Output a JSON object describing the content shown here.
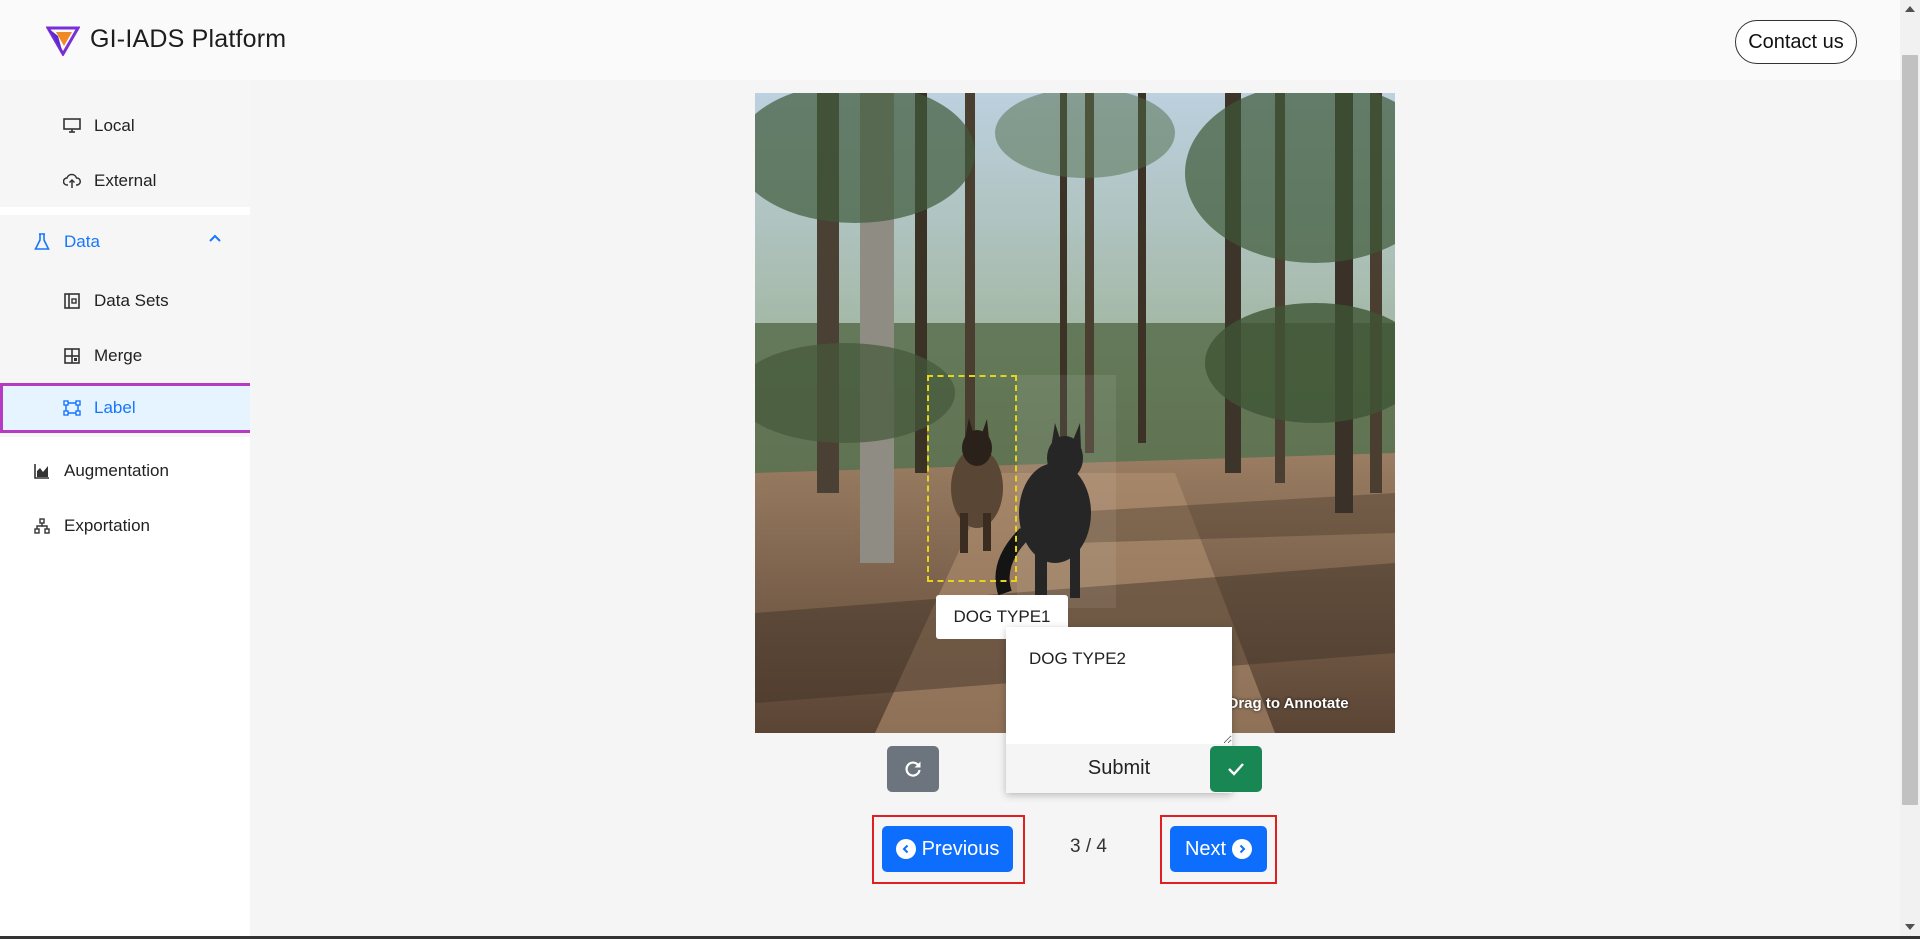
{
  "header": {
    "brand": "GI-IADS Platform",
    "contact_label": "Contact us",
    "logo_icon": "gi-iads-logo-icon"
  },
  "sidebar": {
    "items": [
      {
        "label": "Local",
        "icon": "monitor-icon"
      },
      {
        "label": "External",
        "icon": "cloud-upload-icon"
      },
      {
        "label": "Data",
        "icon": "flask-icon",
        "expanded": true
      },
      {
        "label": "Data Sets",
        "icon": "dataset-icon"
      },
      {
        "label": "Merge",
        "icon": "merge-icon"
      },
      {
        "label": "Label",
        "icon": "bounding-box-icon",
        "selected": true
      },
      {
        "label": "Augmentation",
        "icon": "area-chart-icon"
      },
      {
        "label": "Exportation",
        "icon": "hierarchy-icon"
      }
    ]
  },
  "annotator": {
    "existing_label": "DOG TYPE1",
    "input_value": "DOG TYPE2",
    "submit_label": "Submit",
    "hint": "nd Drag to Annotate"
  },
  "pagination": {
    "previous_label": "Previous",
    "next_label": "Next",
    "page_indicator": "3 / 4"
  },
  "colors": {
    "accent": "#1677ff",
    "primary_button": "#0d6efd",
    "reset_button": "#6c757d",
    "confirm_button": "#198754",
    "selection_outline": "#b43bc2",
    "highlight_frame": "#e02020",
    "bbox_stroke": "#e6d51a"
  }
}
